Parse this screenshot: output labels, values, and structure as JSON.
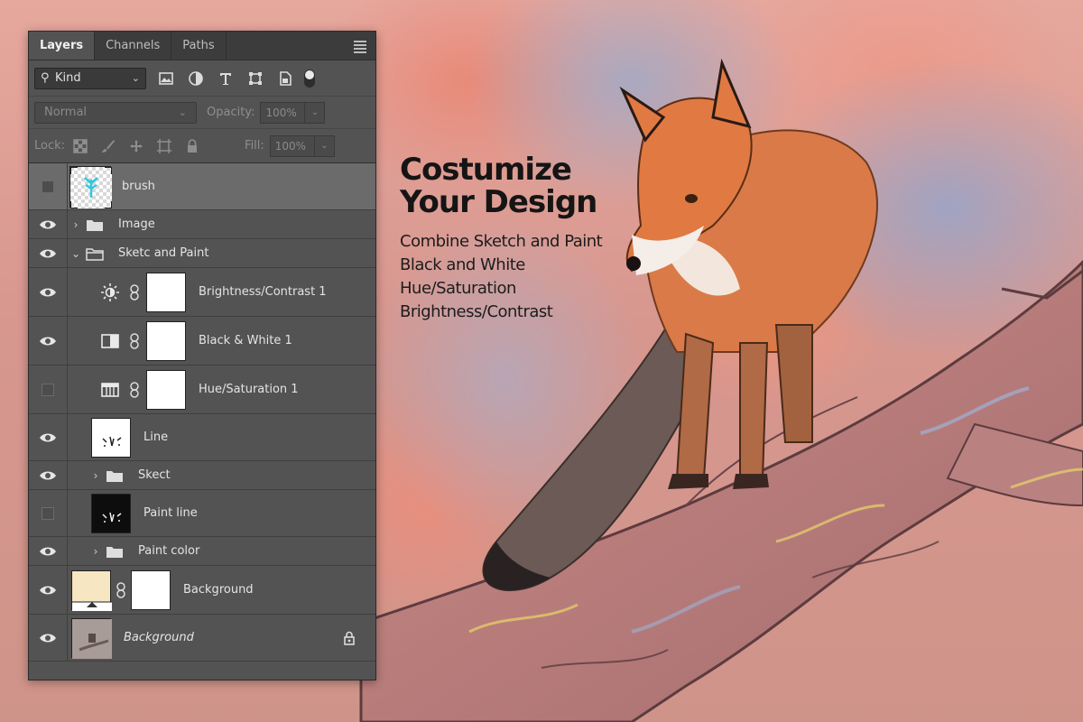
{
  "panel": {
    "tabs": [
      {
        "label": "Layers",
        "active": true
      },
      {
        "label": "Channels",
        "active": false
      },
      {
        "label": "Paths",
        "active": false
      }
    ],
    "filter": {
      "kind_label": "Kind"
    },
    "blend_mode": "Normal",
    "opacity_label": "Opacity:",
    "opacity_value": "100%",
    "lock_label": "Lock:",
    "fill_label": "Fill:",
    "fill_value": "100%"
  },
  "layers": [
    {
      "name": "brush",
      "visible": false,
      "selected": true,
      "type": "pixel"
    },
    {
      "name": "Image",
      "visible": true,
      "type": "group",
      "expanded": false
    },
    {
      "name": "Sketc and Paint",
      "visible": true,
      "type": "group",
      "expanded": true
    },
    {
      "name": "Brightness/Contrast 1",
      "visible": true,
      "type": "adjustment",
      "icon": "sun-icon"
    },
    {
      "name": "Black & White 1",
      "visible": true,
      "type": "adjustment",
      "icon": "black-white-icon"
    },
    {
      "name": "Hue/Saturation 1",
      "visible": false,
      "type": "adjustment",
      "icon": "hue-saturation-icon"
    },
    {
      "name": "Line",
      "visible": true,
      "type": "pixel"
    },
    {
      "name": "Skect",
      "visible": true,
      "type": "group",
      "expanded": false
    },
    {
      "name": "Paint line",
      "visible": false,
      "type": "pixel"
    },
    {
      "name": "Paint color",
      "visible": true,
      "type": "group",
      "expanded": false
    },
    {
      "name": "Background",
      "visible": true,
      "type": "fill"
    },
    {
      "name": "Background",
      "visible": true,
      "type": "background",
      "locked": true
    }
  ],
  "headline": {
    "line1": "Costumize",
    "line2": "Your Design"
  },
  "features": [
    "Combine Sketch and Paint",
    "Black and White",
    "Hue/Saturation",
    "Brightness/Contrast"
  ],
  "colors": {
    "panel_bg": "#535353",
    "selected_row": "#6b6b6b",
    "fill_swatch": "#f7e6c2",
    "brush_icon": "#33c6e0"
  }
}
